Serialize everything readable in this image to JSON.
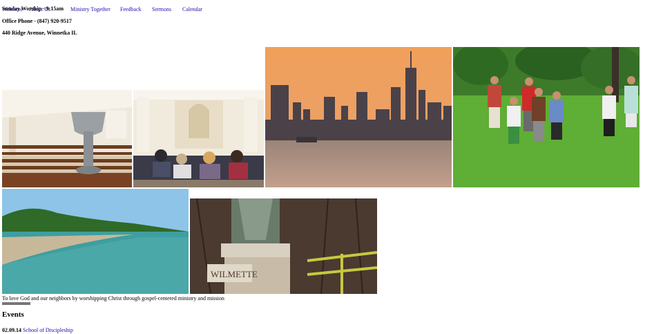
{
  "nav": {
    "items": [
      {
        "label": "Welcome"
      },
      {
        "label": "About Us"
      },
      {
        "label": "Ministry Together"
      },
      {
        "label": "Feedback"
      },
      {
        "label": "Sermons"
      },
      {
        "label": "Calendar"
      }
    ]
  },
  "header": {
    "worship": "Sunday Worship - 9:15am",
    "phone": "Office Phone - (847) 920-9517",
    "address": "440 Ridge Avenue, Winnetka IL"
  },
  "photos": {
    "sign_text": "WILMETTE"
  },
  "mission": "To love God and our neighbors by worshipping Christ through gospel-centered ministry and mission",
  "events": {
    "heading": "Events",
    "items": [
      {
        "date": "02.09.14",
        "title": "School of Discipleship"
      }
    ]
  },
  "colors": {
    "link": "#1a0dab",
    "sunset_top": "#e8a060",
    "sunset_bottom": "#a88a78",
    "grass": "#5fae35",
    "lake": "#3f9ea0"
  }
}
